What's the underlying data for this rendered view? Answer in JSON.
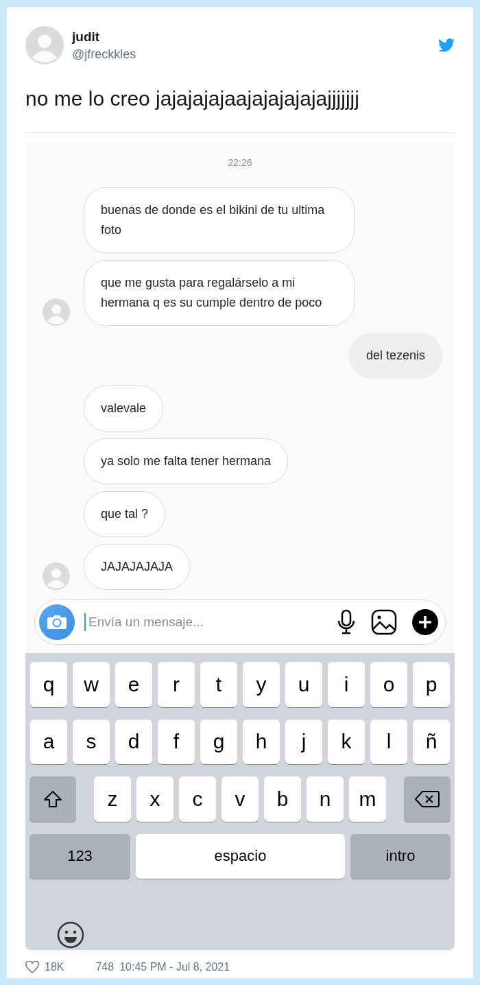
{
  "tweet": {
    "author": {
      "name": "judit",
      "handle": "@jfreckkles"
    },
    "text": "no me lo creo jajajajajaajajajajajajjjjjjj",
    "screenshot": {
      "time": "22:26",
      "messages": [
        {
          "kind": "received",
          "text": "buenas de donde es el bikini de tu ultima foto",
          "avatar": false
        },
        {
          "kind": "received",
          "text": "que me gusta para regalárselo a mi hermana q es su cumple dentro de poco",
          "avatar": true
        },
        {
          "kind": "sent",
          "text": "del tezenis",
          "avatar": false
        },
        {
          "kind": "received",
          "text": "valevale",
          "avatar": false
        },
        {
          "kind": "received",
          "text": "ya solo me falta tener hermana",
          "avatar": false
        },
        {
          "kind": "received",
          "text": "que tal ?",
          "avatar": false
        },
        {
          "kind": "received",
          "text": "JAJAJAJAJA",
          "avatar": true
        }
      ],
      "composer": {
        "placeholder": "Envía un mensaje..."
      },
      "keyboard": {
        "rows": [
          {
            "keys": [
              {
                "kind": "letter",
                "label": "q"
              },
              {
                "kind": "letter",
                "label": "w"
              },
              {
                "kind": "letter",
                "label": "e"
              },
              {
                "kind": "letter",
                "label": "r"
              },
              {
                "kind": "letter",
                "label": "t"
              },
              {
                "kind": "letter",
                "label": "y"
              },
              {
                "kind": "letter",
                "label": "u"
              },
              {
                "kind": "letter",
                "label": "i"
              },
              {
                "kind": "letter",
                "label": "o"
              },
              {
                "kind": "letter",
                "label": "p"
              }
            ]
          },
          {
            "keys": [
              {
                "kind": "letter",
                "label": "a"
              },
              {
                "kind": "letter",
                "label": "s"
              },
              {
                "kind": "letter",
                "label": "d"
              },
              {
                "kind": "letter",
                "label": "f"
              },
              {
                "kind": "letter",
                "label": "g"
              },
              {
                "kind": "letter",
                "label": "h"
              },
              {
                "kind": "letter",
                "label": "j"
              },
              {
                "kind": "letter",
                "label": "k"
              },
              {
                "kind": "letter",
                "label": "l"
              },
              {
                "kind": "letter",
                "label": "ñ"
              }
            ]
          },
          {
            "keys": [
              {
                "kind": "shift"
              },
              {
                "kind": "letter",
                "label": "z"
              },
              {
                "kind": "letter",
                "label": "x"
              },
              {
                "kind": "letter",
                "label": "c"
              },
              {
                "kind": "letter",
                "label": "v"
              },
              {
                "kind": "letter",
                "label": "b"
              },
              {
                "kind": "letter",
                "label": "n"
              },
              {
                "kind": "letter",
                "label": "m"
              },
              {
                "kind": "backspace"
              }
            ]
          },
          {
            "keys": [
              {
                "kind": "mode",
                "label": "123"
              },
              {
                "kind": "space",
                "label": "espacio"
              },
              {
                "kind": "return",
                "label": "intro"
              }
            ]
          },
          {
            "keys": [
              {
                "kind": "emoji"
              }
            ]
          }
        ]
      }
    },
    "likes": "18K",
    "retweets": "748",
    "timestamp": "10:45 PM - Jul 8, 2021"
  }
}
